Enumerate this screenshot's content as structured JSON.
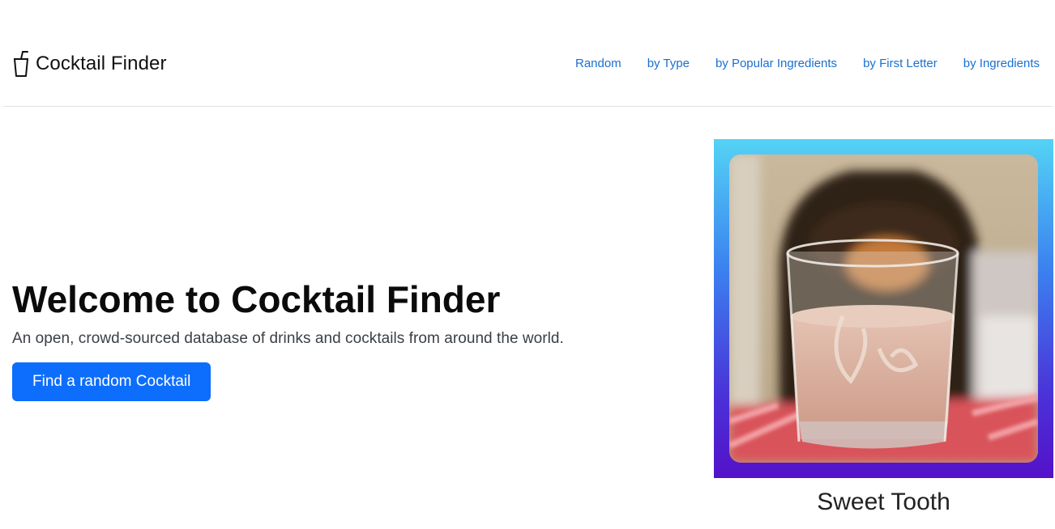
{
  "brand": {
    "name": "Cocktail Finder",
    "icon": "cup-straw-icon"
  },
  "nav": {
    "links": [
      "Random",
      "by Type",
      "by Popular Ingredients",
      "by First Letter",
      "by Ingredients"
    ]
  },
  "hero": {
    "title": "Welcome to Cocktail Finder",
    "subtitle": "An open, crowd-sourced database of drinks and cocktails from around the world.",
    "button_label": "Find a random Cocktail"
  },
  "featured": {
    "name": "Sweet Tooth",
    "image_icon": "cocktail-photo",
    "gradient_colors": [
      "#54d3f5",
      "#3b82f0",
      "#5411c9"
    ]
  },
  "colors": {
    "primary": "#0d6efd",
    "link": "#1a6fd1"
  }
}
